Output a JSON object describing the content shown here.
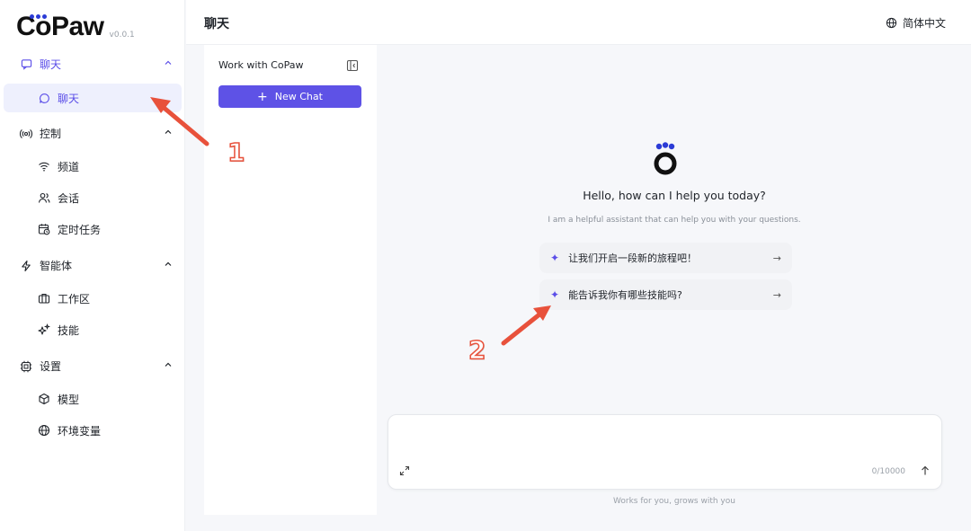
{
  "app": {
    "logo": "CoPaw",
    "version": "v0.0.1"
  },
  "sidebar": {
    "groups": [
      {
        "label": "聊天",
        "items": [
          {
            "label": "聊天"
          }
        ]
      },
      {
        "label": "控制",
        "items": [
          {
            "label": "频道"
          },
          {
            "label": "会话"
          },
          {
            "label": "定时任务"
          }
        ]
      },
      {
        "label": "智能体",
        "items": [
          {
            "label": "工作区"
          },
          {
            "label": "技能"
          }
        ]
      },
      {
        "label": "设置",
        "items": [
          {
            "label": "模型"
          },
          {
            "label": "环境变量"
          }
        ]
      }
    ]
  },
  "header": {
    "title": "聊天",
    "language": "简体中文"
  },
  "session_panel": {
    "title": "Work with CoPaw",
    "new_chat_label": "New Chat"
  },
  "chat": {
    "greeting": "Hello, how can I help you today?",
    "subtitle": "I am a helpful assistant that can help you with your questions.",
    "prompts": [
      {
        "text": "让我们开启一段新的旅程吧！"
      },
      {
        "text": "能告诉我你有哪些技能吗?"
      }
    ],
    "input": {
      "placeholder": "",
      "counter": "0/10000"
    },
    "footer": "Works for you, grows with you"
  },
  "annotations": {
    "first": "1",
    "second": "2"
  },
  "colors": {
    "accent": "#5e52e6",
    "annotation": "#e8513b"
  }
}
